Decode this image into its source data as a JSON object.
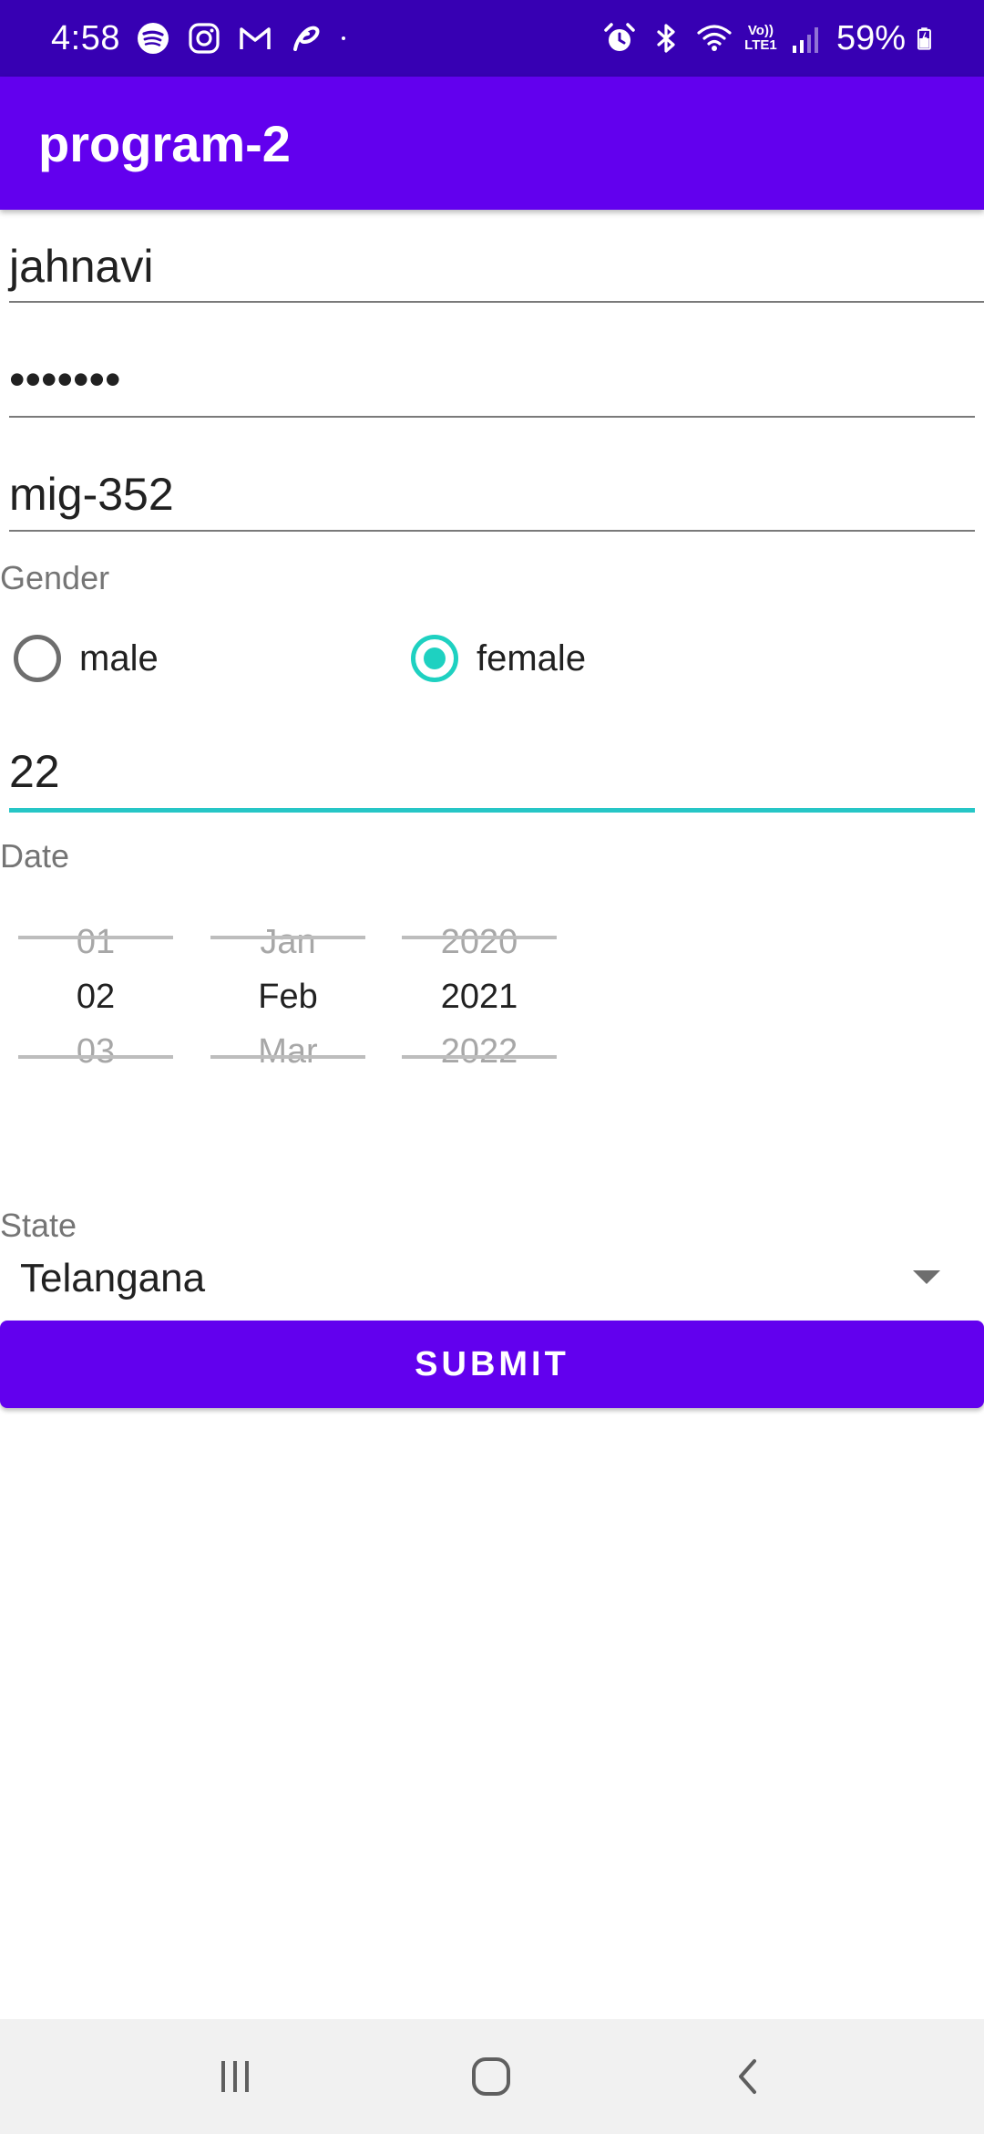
{
  "status_bar": {
    "time": "4:58",
    "battery": "59%",
    "network": "Vo)) LTE1",
    "left_icons": [
      "spotify-icon",
      "instagram-icon",
      "gmail-icon",
      "airtel-icon",
      "dot-icon"
    ],
    "right_icons": [
      "alarm-icon",
      "bluetooth-icon",
      "wifi-icon",
      "lte-icon",
      "signal-icon",
      "battery-icon"
    ]
  },
  "app_bar": {
    "title": "program-2"
  },
  "form": {
    "name_value": "jahnavi",
    "password_value": "•••••••",
    "address_value": "mig-352",
    "gender_label": "Gender",
    "gender_options": [
      {
        "label": "male",
        "checked": false
      },
      {
        "label": "female",
        "checked": true
      }
    ],
    "age_value": "22",
    "date_label": "Date",
    "date_picker": {
      "day": {
        "prev": "01",
        "selected": "02",
        "next": "03"
      },
      "month": {
        "prev": "Jan",
        "selected": "Feb",
        "next": "Mar"
      },
      "year": {
        "prev": "2020",
        "selected": "2021",
        "next": "2022"
      }
    },
    "state_label": "State",
    "state_value": "Telangana",
    "submit_label": "SUBMIT"
  },
  "colors": {
    "status_bar": "#3700b3",
    "primary": "#6200ee",
    "accent": "#1ed1c1",
    "nav_bar": "#f1f1f1"
  },
  "nav_bar": {
    "buttons": [
      "recent-apps-icon",
      "home-icon",
      "back-icon"
    ]
  }
}
